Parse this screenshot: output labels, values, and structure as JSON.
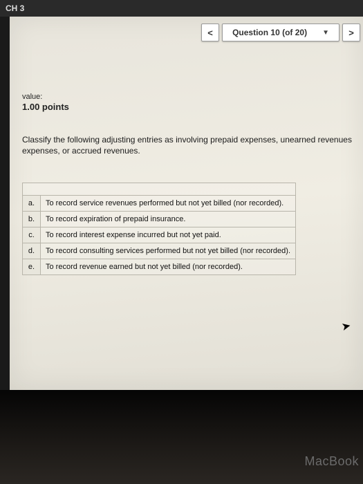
{
  "topbar": {
    "chapter": "CH 3"
  },
  "nav": {
    "prev_glyph": "<",
    "question_label": "Question 10 (of 20)",
    "caret_glyph": "▼",
    "next_glyph": ">"
  },
  "value": {
    "label": "value:",
    "points": "1.00 points"
  },
  "instruction": "Classify the following adjusting entries as involving prepaid expenses, unearned revenues expenses, or accrued revenues.",
  "rows": [
    {
      "letter": "a.",
      "text": "To record service revenues performed but not yet billed (nor recorded)."
    },
    {
      "letter": "b.",
      "text": "To record expiration of prepaid insurance."
    },
    {
      "letter": "c.",
      "text": "To record interest expense incurred but not yet paid."
    },
    {
      "letter": "d.",
      "text": "To record consulting services performed but not yet billed (nor recorded)."
    },
    {
      "letter": "e.",
      "text": "To record revenue earned but not yet billed (nor recorded)."
    }
  ],
  "footer": {
    "device": "MacBook"
  }
}
